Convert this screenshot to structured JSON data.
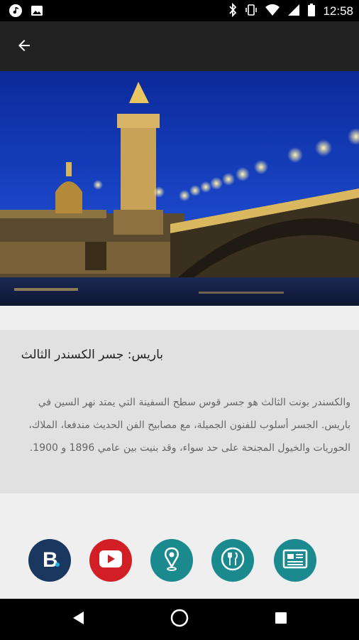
{
  "status_bar": {
    "time": "12:58",
    "left_icons": [
      "music-icon",
      "image-icon"
    ],
    "right_icons": [
      "bluetooth-icon",
      "vibrate-icon",
      "wifi-icon",
      "signal-icon",
      "battery-icon"
    ]
  },
  "app_bar": {
    "back_icon": "arrow-back-icon"
  },
  "hero": {
    "description": "Pont Alexandre III bridge in Paris at night with golden statues and lamps, Les Invalides dome in background"
  },
  "card": {
    "title": "باريس: جسر الكسندر الثالث",
    "description": "والكسندر بونت الثالث هو جسر قوس سطح السفينة التي يمتد نهر السين في باريس. الجسر أسلوب للفنون الجميلة، مع مصابيح الفن الحديث مندفعا، الملاك، الحوريات والخيول المجنحة على حد سواء، وقد بنيت بين عامي 1896 و 1900."
  },
  "actions": [
    {
      "name": "booking-button",
      "icon": "booking-icon",
      "color": "#1a3760",
      "glyph": "B"
    },
    {
      "name": "youtube-button",
      "icon": "youtube-icon",
      "color": "#d21f26"
    },
    {
      "name": "map-button",
      "icon": "map-pin-icon",
      "color": "#1a8a8e"
    },
    {
      "name": "restaurant-button",
      "icon": "restaurant-icon",
      "color": "#1a8a8e"
    },
    {
      "name": "news-button",
      "icon": "newspaper-icon",
      "color": "#1a8a8e"
    }
  ],
  "nav_bar": {
    "icons": [
      "back-nav-icon",
      "home-nav-icon",
      "recents-nav-icon"
    ]
  }
}
